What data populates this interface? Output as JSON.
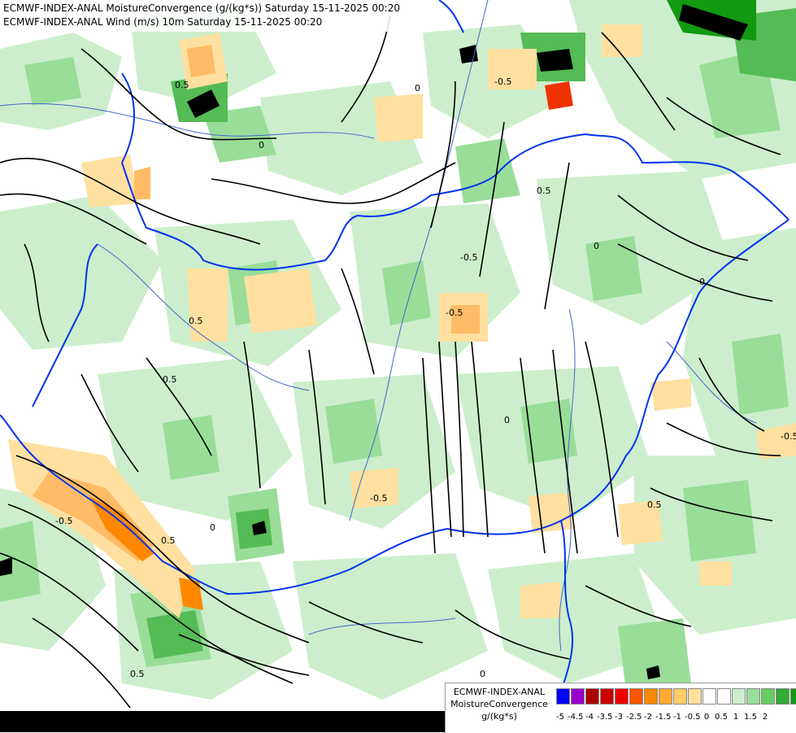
{
  "header": {
    "line1": "ECMWF-INDEX-ANAL MoistureConvergence (g/(kg*s)) Saturday 15-11-2025 00:20",
    "line2": "ECMWF-INDEX-ANAL Wind (m/s) 10m Saturday 15-11-2025 00:20"
  },
  "legend": {
    "title_line1": "ECMWF-INDEX-ANAL",
    "title_line2": "MoistureConvergence",
    "unit": "g/(kg*s)",
    "colors": [
      "#0000ff",
      "#9900cc",
      "#aa0000",
      "#cc0000",
      "#ee0000",
      "#ff5500",
      "#ff8800",
      "#ffaa33",
      "#ffcc66",
      "#ffe0a0",
      "#ffffff",
      "#ffffff",
      "#cceecc",
      "#99dd99",
      "#66cc66",
      "#33aa33",
      "#119911"
    ],
    "ticks": [
      "-5",
      "-4.5",
      "-4",
      "-3.5",
      "-3",
      "-2.5",
      "-2",
      "-1.5",
      "-1",
      "-0.5",
      "0",
      "0.5",
      "1",
      "1.5",
      "2"
    ]
  },
  "map": {
    "colors": {
      "background": "#ffffff",
      "weak_convergence": "#cceecc",
      "moderate_convergence": "#99dd99",
      "strong_convergence": "#55bb55",
      "very_strong_convergence": "#119911",
      "extreme": "#000000",
      "weak_divergence": "#ffe0a0",
      "moderate_divergence": "#ffbb66",
      "strong_divergence": "#ff8800",
      "very_strong_divergence": "#ee3300",
      "border": "#0033ee",
      "river": "#4466cc",
      "streamline": "#000000"
    },
    "contour_labels": [
      "0",
      "0.5",
      "-0.5",
      "0",
      "0.5",
      "-0.5",
      "0",
      "0.5",
      "-0.5",
      "0",
      "0.5",
      "-0.5",
      "0",
      "0.5",
      "-0.5",
      "0",
      "0.5",
      "-0.5",
      "0",
      "0.5"
    ]
  }
}
